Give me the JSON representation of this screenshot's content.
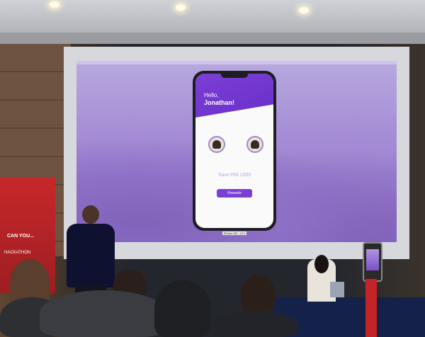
{
  "app_screen": {
    "greeting_line1": "Hello,",
    "greeting_line2": "Jonathan!",
    "save_text": "Save RM 1000",
    "rewards_button": "Rewards"
  },
  "phone_caption": "iPhone XR - 12.1",
  "banner": {
    "line1": "CAN YOU...",
    "line2": "HACKATHON"
  },
  "colors": {
    "app_purple": "#7b3fd6",
    "banner_red": "#c8282b"
  }
}
